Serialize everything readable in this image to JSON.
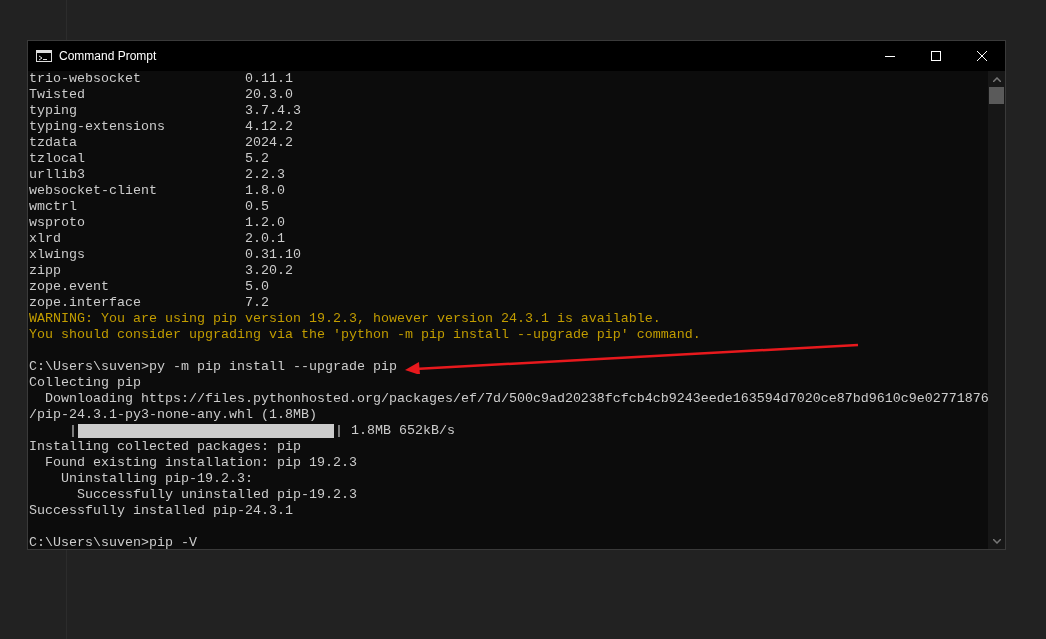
{
  "window": {
    "title": "Command Prompt"
  },
  "lines": [
    {
      "kind": "package",
      "name": "trio-websocket",
      "version": "0.11.1"
    },
    {
      "kind": "package",
      "name": "Twisted",
      "version": "20.3.0"
    },
    {
      "kind": "package",
      "name": "typing",
      "version": "3.7.4.3"
    },
    {
      "kind": "package",
      "name": "typing-extensions",
      "version": "4.12.2"
    },
    {
      "kind": "package",
      "name": "tzdata",
      "version": "2024.2"
    },
    {
      "kind": "package",
      "name": "tzlocal",
      "version": "5.2"
    },
    {
      "kind": "package",
      "name": "urllib3",
      "version": "2.2.3"
    },
    {
      "kind": "package",
      "name": "websocket-client",
      "version": "1.8.0"
    },
    {
      "kind": "package",
      "name": "wmctrl",
      "version": "0.5"
    },
    {
      "kind": "package",
      "name": "wsproto",
      "version": "1.2.0"
    },
    {
      "kind": "package",
      "name": "xlrd",
      "version": "2.0.1"
    },
    {
      "kind": "package",
      "name": "xlwings",
      "version": "0.31.10"
    },
    {
      "kind": "package",
      "name": "zipp",
      "version": "3.20.2"
    },
    {
      "kind": "package",
      "name": "zope.event",
      "version": "5.0"
    },
    {
      "kind": "package",
      "name": "zope.interface",
      "version": "7.2"
    },
    {
      "kind": "warning",
      "text": "WARNING: You are using pip version 19.2.3, however version 24.3.1 is available."
    },
    {
      "kind": "warning",
      "text": "You should consider upgrading via the 'python -m pip install --upgrade pip' command."
    },
    {
      "kind": "blank"
    },
    {
      "kind": "text",
      "text": "C:\\Users\\suven>py -m pip install --upgrade pip"
    },
    {
      "kind": "text",
      "text": "Collecting pip"
    },
    {
      "kind": "text",
      "text": "  Downloading https://files.pythonhosted.org/packages/ef/7d/500c9ad20238fcfcb4cb9243eede163594d7020ce87bd9610c9e02771876"
    },
    {
      "kind": "text",
      "text": "/pip-24.3.1-py3-none-any.whl (1.8MB)"
    },
    {
      "kind": "progress",
      "left": "|",
      "level": 1,
      "reading": "| 1.8MB 652kB/s"
    },
    {
      "kind": "text",
      "text": "Installing collected packages: pip"
    },
    {
      "kind": "text",
      "text": "  Found existing installation: pip 19.2.3"
    },
    {
      "kind": "text",
      "text": "    Uninstalling pip-19.2.3:"
    },
    {
      "kind": "text",
      "text": "      Successfully uninstalled pip-19.2.3"
    },
    {
      "kind": "text",
      "text": "Successfully installed pip-24.3.1"
    },
    {
      "kind": "blank"
    },
    {
      "kind": "text",
      "text": "C:\\Users\\suven>pip -V"
    }
  ]
}
